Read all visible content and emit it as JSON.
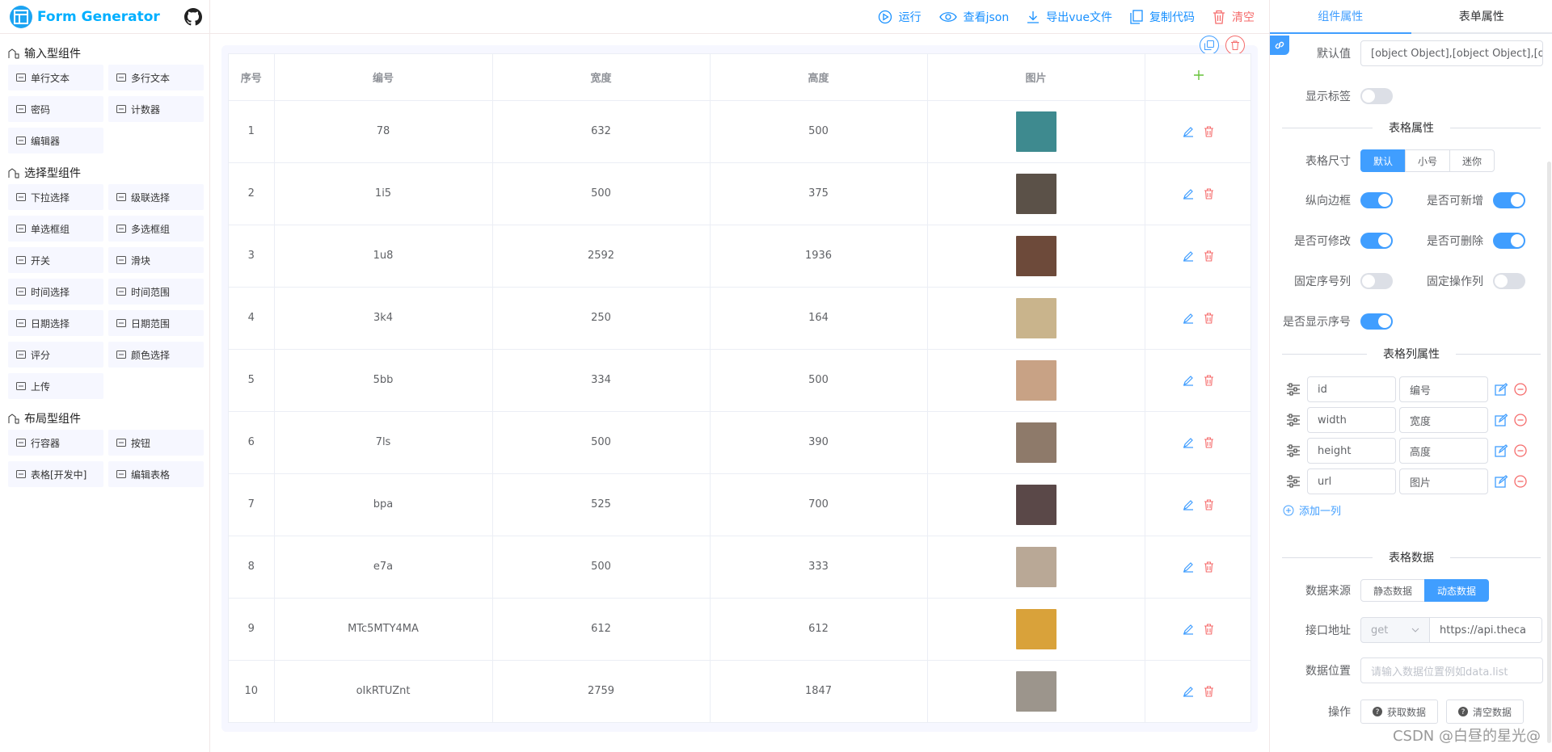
{
  "app": {
    "title": "Form Generator",
    "watermark": "CSDN @白昼的星光@"
  },
  "sidebar": {
    "groups": [
      {
        "title": "输入型组件",
        "items": [
          "单行文本",
          "多行文本",
          "密码",
          "计数器",
          "编辑器"
        ]
      },
      {
        "title": "选择型组件",
        "items": [
          "下拉选择",
          "级联选择",
          "单选框组",
          "多选框组",
          "开关",
          "滑块",
          "时间选择",
          "时间范围",
          "日期选择",
          "日期范围",
          "评分",
          "颜色选择",
          "上传"
        ]
      },
      {
        "title": "布局型组件",
        "items": [
          "行容器",
          "按钮",
          "表格[开发中]",
          "编辑表格"
        ]
      }
    ]
  },
  "toolbar": {
    "run": "运行",
    "view_json": "查看json",
    "export_vue": "导出vue文件",
    "copy_code": "复制代码",
    "clear": "清空"
  },
  "table": {
    "headers": [
      "序号",
      "编号",
      "宽度",
      "高度",
      "图片"
    ],
    "rows": [
      {
        "index": "1",
        "id": "78",
        "width": "632",
        "height": "500",
        "color": "#3e8a8f"
      },
      {
        "index": "2",
        "id": "1i5",
        "width": "500",
        "height": "375",
        "color": "#5b5148"
      },
      {
        "index": "3",
        "id": "1u8",
        "width": "2592",
        "height": "1936",
        "color": "#6d4a3a"
      },
      {
        "index": "4",
        "id": "3k4",
        "width": "250",
        "height": "164",
        "color": "#c9b48c"
      },
      {
        "index": "5",
        "id": "5bb",
        "width": "334",
        "height": "500",
        "color": "#c8a285"
      },
      {
        "index": "6",
        "id": "7ls",
        "width": "500",
        "height": "390",
        "color": "#8e7a6a"
      },
      {
        "index": "7",
        "id": "bpa",
        "width": "525",
        "height": "700",
        "color": "#5a4848"
      },
      {
        "index": "8",
        "id": "e7a",
        "width": "500",
        "height": "333",
        "color": "#b9a896"
      },
      {
        "index": "9",
        "id": "MTc5MTY4MA",
        "width": "612",
        "height": "612",
        "color": "#d9a23a"
      },
      {
        "index": "10",
        "id": "oIkRTUZnt",
        "width": "2759",
        "height": "1847",
        "color": "#9c958c"
      }
    ]
  },
  "panel": {
    "tabs": [
      "组件属性",
      "表单属性"
    ],
    "default_value_label": "默认值",
    "default_value": "[object Object],[object Object],[ob",
    "show_label": "显示标签",
    "section_table_props": "表格属性",
    "table_size_label": "表格尺寸",
    "sizes": [
      "默认",
      "小号",
      "迷你"
    ],
    "border": "纵向边框",
    "can_add": "是否可新增",
    "can_edit": "是否可修改",
    "can_delete": "是否可删除",
    "fix_index": "固定序号列",
    "fix_ops": "固定操作列",
    "show_index": "是否显示序号",
    "section_columns": "表格列属性",
    "columns": [
      {
        "prop": "id",
        "label": "编号"
      },
      {
        "prop": "width",
        "label": "宽度"
      },
      {
        "prop": "height",
        "label": "高度"
      },
      {
        "prop": "url",
        "label": "图片"
      }
    ],
    "add_column": "添加一列",
    "section_data": "表格数据",
    "data_source_label": "数据来源",
    "sources": [
      "静态数据",
      "动态数据"
    ],
    "api_label": "接口地址",
    "method": "get",
    "api_url": "https://api.theca",
    "data_path_label": "数据位置",
    "data_path_placeholder": "请输入数据位置例如data.list",
    "ops_label": "操作",
    "fetch_btn": "获取数据",
    "clear_btn": "清空数据"
  }
}
